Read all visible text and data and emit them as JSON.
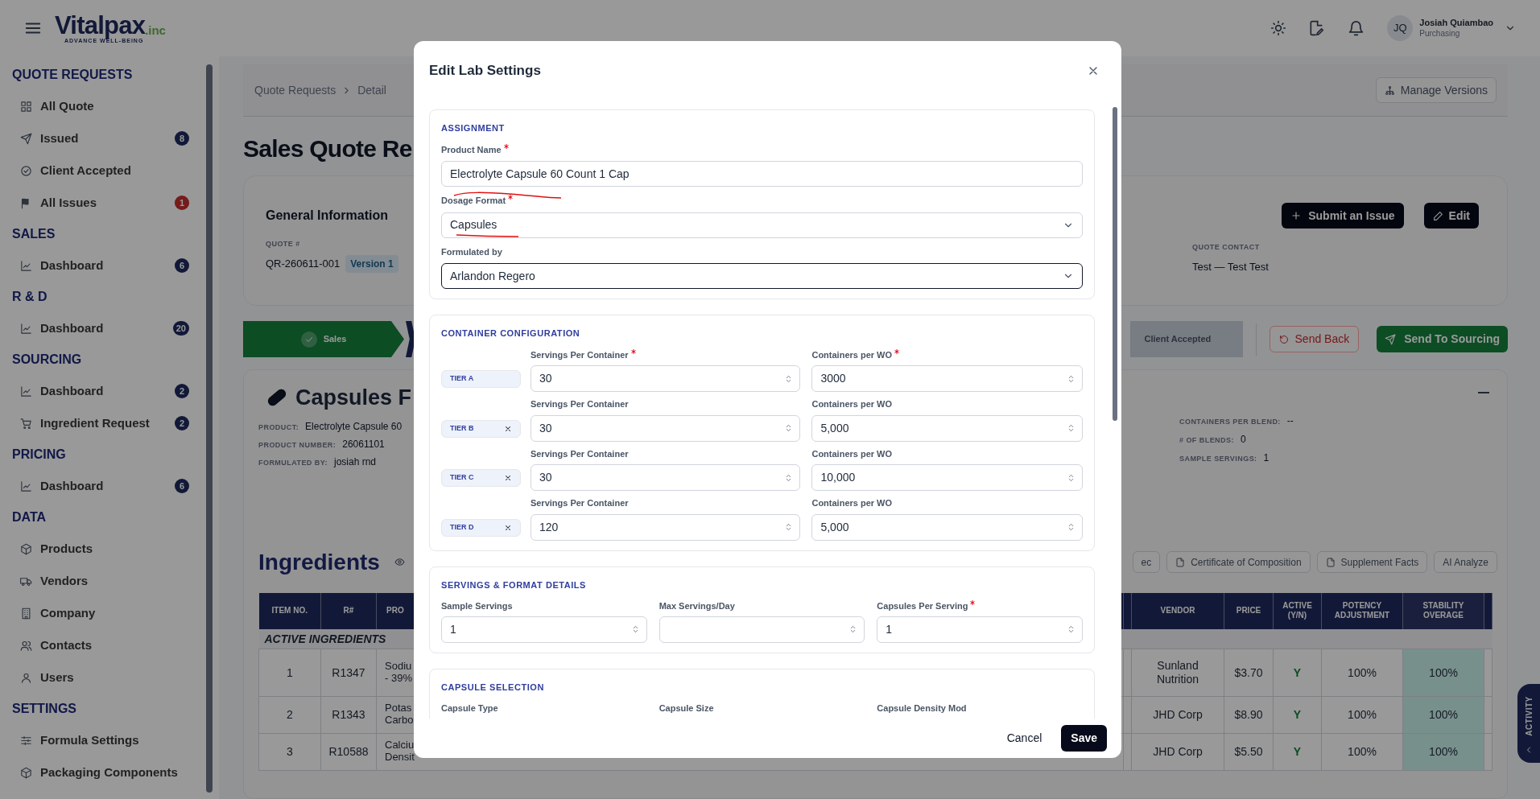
{
  "app": {
    "logo": "Vitalpax",
    "logo_suffix": ".inc",
    "tagline": "ADVANCE WELL-BEING"
  },
  "header": {
    "user": {
      "initials": "JQ",
      "name": "Josiah Quiambao",
      "role": "Purchasing"
    }
  },
  "sidebar": {
    "sections": [
      {
        "title": "QUOTE REQUESTS",
        "items": [
          {
            "label": "All Quote"
          },
          {
            "label": "Issued",
            "badge": {
              "text": "8",
              "color": "#121938"
            }
          },
          {
            "label": "Client Accepted"
          },
          {
            "label": "All Issues",
            "badge": {
              "text": "1",
              "color": "#761a1a"
            }
          }
        ]
      },
      {
        "title": "SALES",
        "items": [
          {
            "label": "Dashboard",
            "badge": {
              "text": "6",
              "color": "#121938"
            }
          }
        ]
      },
      {
        "title": "R & D",
        "items": [
          {
            "label": "Dashboard",
            "badge": {
              "text": "20",
              "color": "#121938"
            }
          }
        ]
      },
      {
        "title": "SOURCING",
        "items": [
          {
            "label": "Dashboard",
            "badge": {
              "text": "2",
              "color": "#121938"
            }
          },
          {
            "label": "Ingredient Request",
            "badge": {
              "text": "2",
              "color": "#121938"
            }
          }
        ]
      },
      {
        "title": "PRICING",
        "items": [
          {
            "label": "Dashboard",
            "badge": {
              "text": "6",
              "color": "#121938"
            }
          }
        ]
      },
      {
        "title": "DATA",
        "items": [
          {
            "label": "Products"
          },
          {
            "label": "Vendors"
          },
          {
            "label": "Company"
          },
          {
            "label": "Contacts"
          },
          {
            "label": "Users"
          }
        ]
      },
      {
        "title": "SETTINGS",
        "items": [
          {
            "label": "Formula Settings"
          },
          {
            "label": "Packaging Components"
          }
        ]
      }
    ]
  },
  "breadcrumb": [
    "Quote Requests",
    "Detail"
  ],
  "manage_versions": "Manage Versions",
  "page_title": "Sales Quote Re",
  "general_info": {
    "title": "General Information",
    "quote_label": "QUOTE #",
    "quote_value": "QR-260611-001",
    "version": "Version 1",
    "contact_label": "QUOTE CONTACT",
    "contact_value": "Test — Test Test",
    "actions": [
      "Submit an Issue",
      "Edit"
    ]
  },
  "workflow": {
    "steps": [
      {
        "label": "Sales",
        "completed": true
      },
      {
        "label": "Client Accepted",
        "completed": false
      }
    ],
    "send_back": "Send Back",
    "send_forward": "Send To Sourcing"
  },
  "product_card": {
    "title": "Capsules F",
    "fields": [
      {
        "label": "PRODUCT:",
        "value": "Electrolyte Capsule 60"
      },
      {
        "label": "PRODUCT NUMBER:",
        "value": "26061101"
      },
      {
        "label": "FORMULATED BY:",
        "value": "josiah rnd"
      }
    ],
    "summary": [
      {
        "label": "CONTAINERS PER BLEND:",
        "value": "--"
      },
      {
        "label": "# OF BLENDS:",
        "value": "0"
      },
      {
        "label": "SAMPLE SERVINGS:",
        "value": "1"
      }
    ]
  },
  "ingredients": {
    "title": "Ingredients",
    "buttons": [
      "ec",
      "Certificate of Composition",
      "Supplement Facts",
      "AI Analyze"
    ],
    "columns_left": [
      "ITEM NO.",
      "R#",
      "PRO"
    ],
    "columns_right": [
      "VENDOR",
      "PRICE",
      "ACTIVE (Y/N)",
      "POTENCY ADJUSTMENT",
      "STABILITY OVERAGE"
    ],
    "group": "ACTIVE INGREDIENTS",
    "rows": [
      {
        "item": "1",
        "r": "R1347",
        "product": [
          "Sodiu",
          "- 39%"
        ],
        "vendor": "Sunland Nutrition",
        "price": "$3.70",
        "active": "Y",
        "potency": "100%",
        "stability": "100%"
      },
      {
        "item": "2",
        "r": "R1343",
        "product": [
          "Potas",
          "Carbo"
        ],
        "vendor": "JHD Corp",
        "price": "$8.90",
        "active": "Y",
        "potency": "100%",
        "stability": "100%"
      },
      {
        "item": "3",
        "r": "R10588",
        "product": [
          "Calciu",
          "Densit"
        ],
        "vendor": "JHD Corp",
        "price": "$5.50",
        "active": "Y",
        "potency": "100%",
        "stability": "100%"
      }
    ]
  },
  "activity_tab": "ACTIVITY",
  "modal": {
    "title": "Edit Lab Settings",
    "sections": [
      {
        "kind": "fields",
        "title": "ASSIGNMENT",
        "fields": [
          {
            "label": "Product Name",
            "required": true,
            "kind": "text",
            "value": "Electrolyte Capsule 60 Count 1 Cap",
            "focused": false
          },
          {
            "label": "Dosage Format",
            "required": true,
            "kind": "select",
            "value": "Capsules",
            "focused": false
          },
          {
            "label": "Formulated by",
            "required": false,
            "kind": "select",
            "value": "Arlandon Regero",
            "focused": true
          }
        ]
      },
      {
        "kind": "tiers",
        "title": "CONTAINER CONFIGURATION",
        "tiers": [
          {
            "label": "TIER A",
            "removable": false,
            "servings": {
              "label": "Servings Per Container",
              "required": true,
              "value": "30"
            },
            "containers": {
              "label": "Containers per WO",
              "required": true,
              "value": "3000"
            }
          },
          {
            "label": "TIER B",
            "removable": true,
            "servings": {
              "label": "Servings Per Container",
              "required": false,
              "value": "30"
            },
            "containers": {
              "label": "Containers per WO",
              "required": false,
              "value": "5,000"
            }
          },
          {
            "label": "TIER C",
            "removable": true,
            "servings": {
              "label": "Servings Per Container",
              "required": false,
              "value": "30"
            },
            "containers": {
              "label": "Containers per WO",
              "required": false,
              "value": "10,000"
            }
          },
          {
            "label": "TIER D",
            "removable": true,
            "servings": {
              "label": "Servings Per Container",
              "required": false,
              "value": "120"
            },
            "containers": {
              "label": "Containers per WO",
              "required": false,
              "value": "5,000"
            }
          }
        ]
      },
      {
        "kind": "grid",
        "title": "SERVINGS & FORMAT DETAILS",
        "fields": [
          {
            "label": "Sample Servings",
            "required": false,
            "value": "1"
          },
          {
            "label": "Max Servings/Day",
            "required": false
          },
          {
            "label": "Capsules Per Serving",
            "required": true,
            "value": "1"
          }
        ]
      },
      {
        "kind": "labels",
        "title": "CAPSULE SELECTION",
        "fields": [
          {
            "label": "Capsule Type"
          },
          {
            "label": "Capsule Size"
          },
          {
            "label": "Capsule Density Mod"
          }
        ]
      }
    ],
    "cancel": "Cancel",
    "save": "Save"
  }
}
